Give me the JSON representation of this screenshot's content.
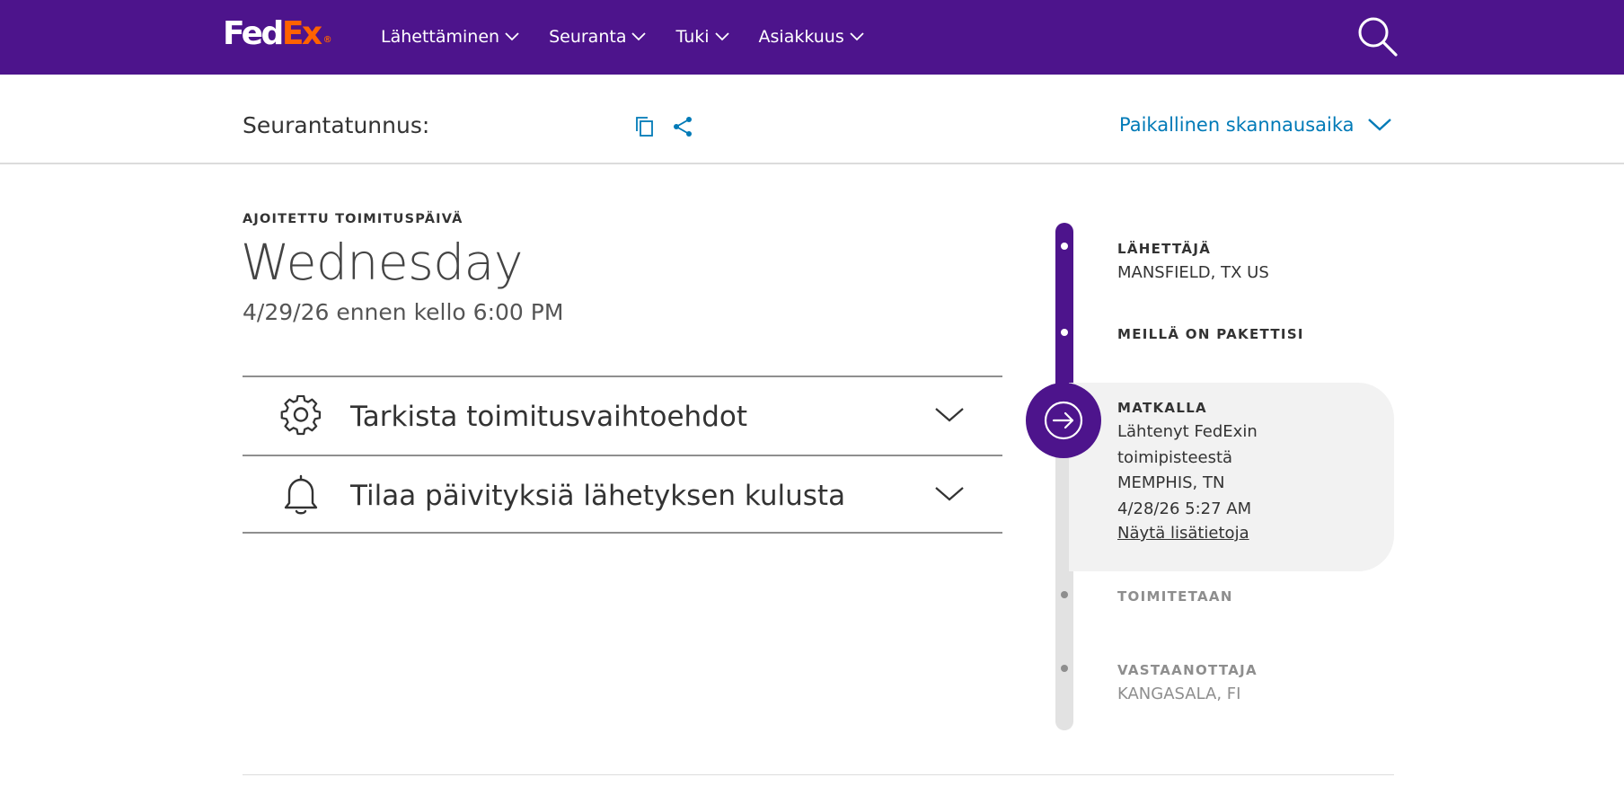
{
  "header": {
    "logo": {
      "fed": "Fed",
      "ex": "Ex",
      "reg": "®"
    },
    "brand_colors": {
      "purple": "#4d148c",
      "orange": "#ff6200"
    },
    "nav": [
      {
        "label": "Lähettäminen",
        "icon": "chevron-down-icon"
      },
      {
        "label": "Seuranta",
        "icon": "chevron-down-icon"
      },
      {
        "label": "Tuki",
        "icon": "chevron-down-icon"
      },
      {
        "label": "Asiakkuus",
        "icon": "chevron-down-icon"
      }
    ],
    "search_icon": "search-icon"
  },
  "tracking": {
    "label": "Seurantatunnus:",
    "copy_icon": "copy-icon",
    "share_icon": "share-icon",
    "local_time_label": "Paikallinen skannausaika",
    "link_color": "#007ab7"
  },
  "delivery": {
    "label": "AJOITETTU TOIMITUSPÄIVÄ",
    "weekday": "Wednesday",
    "date_line": "4/29/26 ennen kello 6:00 PM"
  },
  "accordions": [
    {
      "title": "Tarkista toimitusvaihtoehdot",
      "icon": "gear-icon"
    },
    {
      "title": "Tilaa päivityksiä lähetyksen kulusta",
      "icon": "bell-icon"
    }
  ],
  "timeline": {
    "steps": [
      {
        "title": "LÄHETTÄJÄ",
        "detail": "MANSFIELD, TX US",
        "state": "done"
      },
      {
        "title": "MEILLÄ ON PAKETTISI",
        "state": "done"
      },
      {
        "title": "MATKALLA",
        "state": "current",
        "icon": "arrow-right-circle-icon",
        "lines": [
          "Lähtenyt FedExin",
          "toimipisteestä",
          "MEMPHIS, TN",
          "4/28/26 5:27 AM"
        ],
        "link": "Näytä lisätietoja"
      },
      {
        "title": "TOIMITETAAN",
        "state": "pending"
      },
      {
        "title": "VASTAANOTTAJA",
        "detail": "KANGASALA, FI",
        "state": "pending"
      }
    ]
  }
}
